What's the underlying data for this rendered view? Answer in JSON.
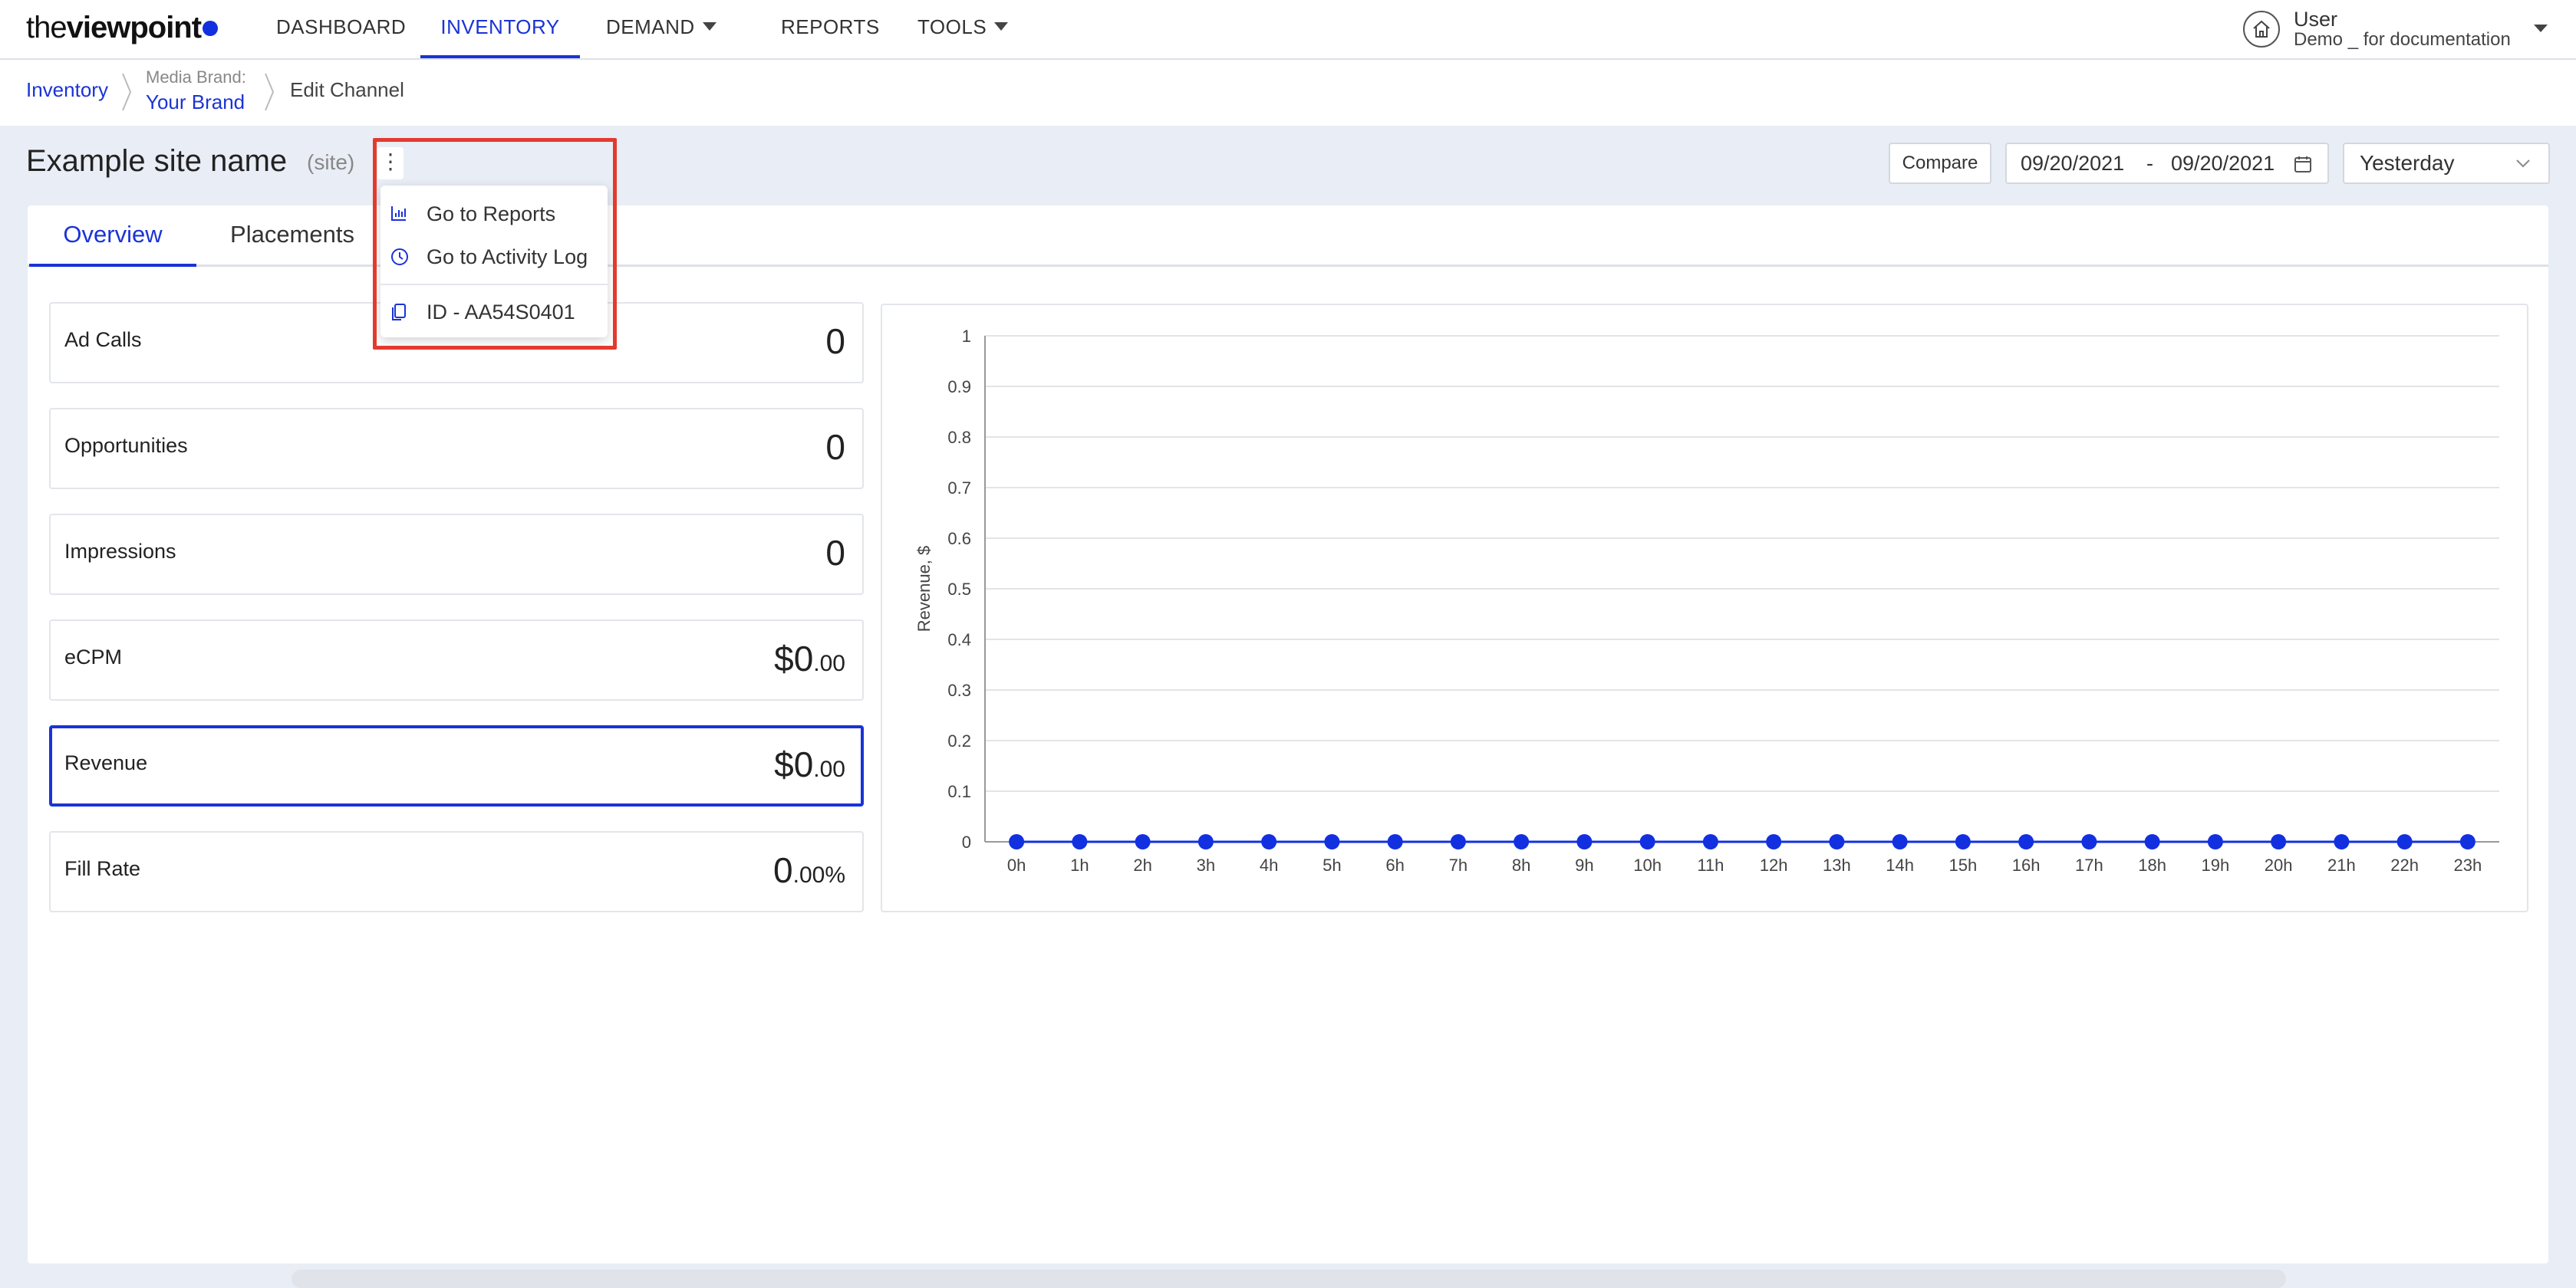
{
  "logo": {
    "part1": "the",
    "part2": "viewpoint"
  },
  "nav": {
    "items": [
      {
        "label": "DASHBOARD",
        "active": false,
        "dropdown": false
      },
      {
        "label": "INVENTORY",
        "active": true,
        "dropdown": false
      },
      {
        "label": "DEMAND",
        "active": false,
        "dropdown": true
      },
      {
        "label": "REPORTS",
        "active": false,
        "dropdown": false
      },
      {
        "label": "TOOLS",
        "active": false,
        "dropdown": true
      }
    ]
  },
  "user": {
    "name": "User",
    "org": "Demo _ for documentation"
  },
  "breadcrumb": {
    "root": "Inventory",
    "brand_label": "Media Brand:",
    "brand": "Your Brand",
    "current": "Edit Channel"
  },
  "header": {
    "title": "Example site name",
    "type": "(site)",
    "kebab": "⋮"
  },
  "controls": {
    "compare": "Compare",
    "date_from": "09/20/2021",
    "date_sep": "-",
    "date_to": "09/20/2021",
    "period": "Yesterday"
  },
  "tabs": [
    {
      "label": "Overview",
      "active": true
    },
    {
      "label": "Placements",
      "active": false
    }
  ],
  "metrics": [
    {
      "label": "Ad Calls",
      "value": "0",
      "fraction": "",
      "selected": false
    },
    {
      "label": "Opportunities",
      "value": "0",
      "fraction": "",
      "selected": false
    },
    {
      "label": "Impressions",
      "value": "0",
      "fraction": "",
      "selected": false
    },
    {
      "label": "eCPM",
      "value": "$0",
      "fraction": ".00",
      "selected": false
    },
    {
      "label": "Revenue",
      "value": "$0",
      "fraction": ".00",
      "selected": true
    },
    {
      "label": "Fill Rate",
      "value": "0",
      "fraction": ".00%",
      "selected": false
    }
  ],
  "menu": {
    "items": [
      {
        "label": "Go to Reports",
        "icon": "bar-chart-icon"
      },
      {
        "label": "Go to Activity Log",
        "icon": "clock-icon"
      },
      {
        "label": "ID - AA54S0401",
        "icon": "copy-icon"
      }
    ]
  },
  "chart_data": {
    "type": "line",
    "title": "",
    "xlabel": "",
    "ylabel": "Revenue, $",
    "x": [
      "0h",
      "1h",
      "2h",
      "3h",
      "4h",
      "5h",
      "6h",
      "7h",
      "8h",
      "9h",
      "10h",
      "11h",
      "12h",
      "13h",
      "14h",
      "15h",
      "16h",
      "17h",
      "18h",
      "19h",
      "20h",
      "21h",
      "22h",
      "23h"
    ],
    "series": [
      {
        "values": [
          0,
          0,
          0,
          0,
          0,
          0,
          0,
          0,
          0,
          0,
          0,
          0,
          0,
          0,
          0,
          0,
          0,
          0,
          0,
          0,
          0,
          0,
          0,
          0
        ],
        "color": "#1230e0"
      }
    ],
    "ylim": [
      0,
      1
    ],
    "yticks": [
      "0",
      "0.1",
      "0.2",
      "0.3",
      "0.4",
      "0.5",
      "0.6",
      "0.7",
      "0.8",
      "0.9",
      "1"
    ],
    "grid": true,
    "legend": "none"
  },
  "colors": {
    "accent": "#1a33d6",
    "highlight": "#e23b2e",
    "series": "#1230e0"
  }
}
